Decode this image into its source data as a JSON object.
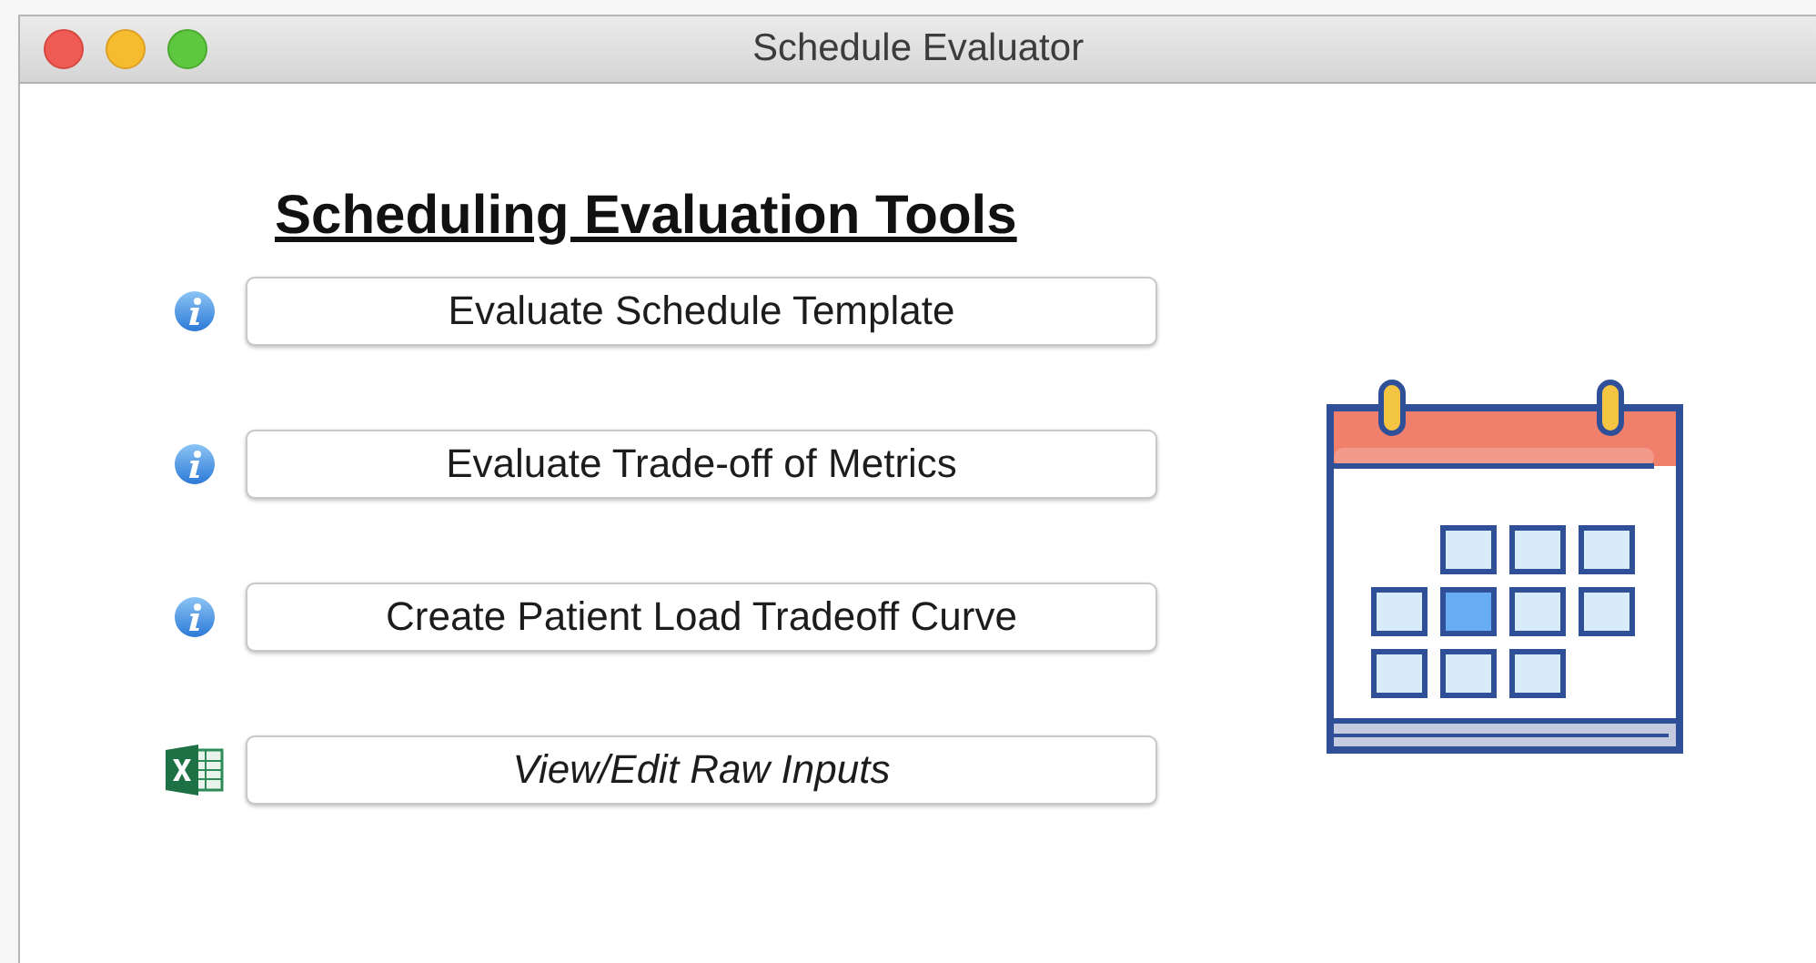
{
  "window": {
    "title": "Schedule Evaluator"
  },
  "heading": "Scheduling Evaluation Tools",
  "tools": [
    {
      "kind": "info",
      "label": "Evaluate Schedule Template",
      "italic": false
    },
    {
      "kind": "info",
      "label": "Evaluate Trade-off of Metrics",
      "italic": false
    },
    {
      "kind": "info",
      "label": "Create Patient Load Tradeoff Curve",
      "italic": false
    },
    {
      "kind": "spreadsheet",
      "label": "View/Edit Raw Inputs",
      "italic": true
    }
  ]
}
